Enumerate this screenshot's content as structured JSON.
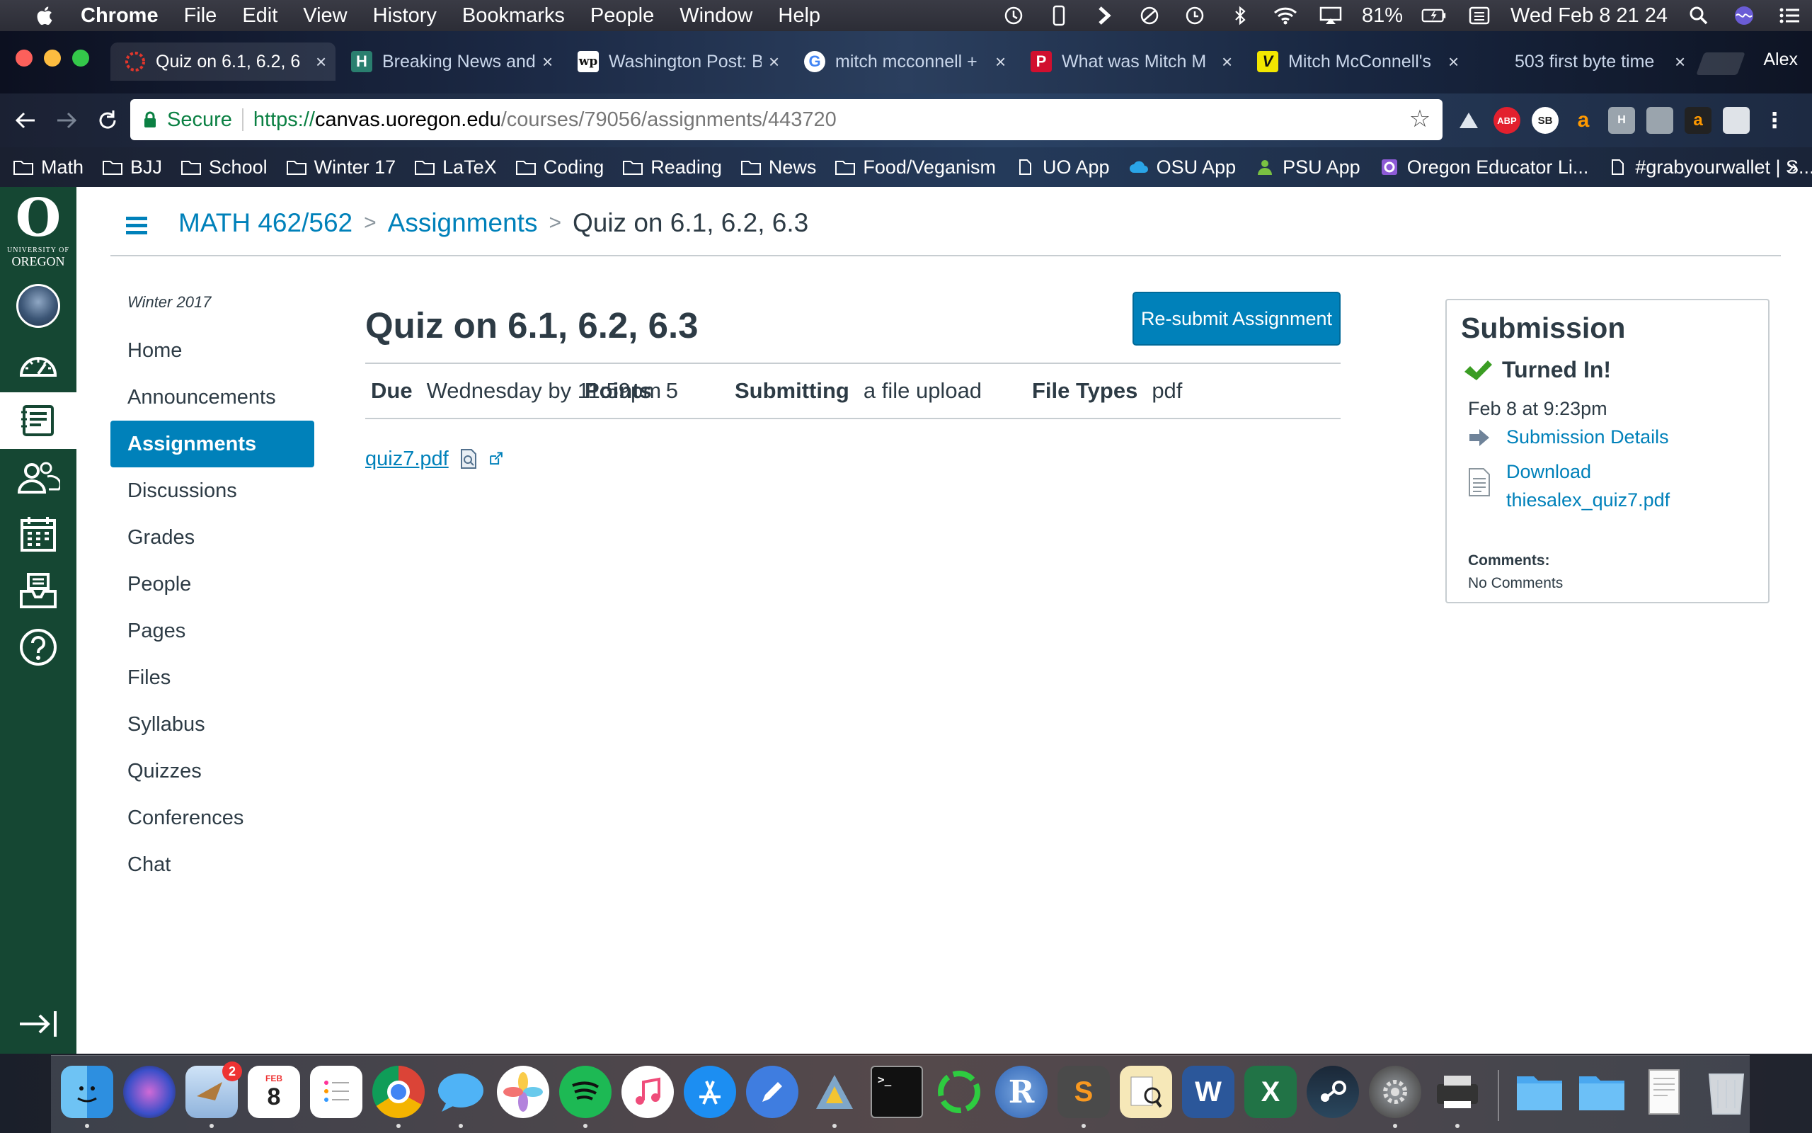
{
  "menubar": {
    "apple_icon": "apple-logo-icon",
    "items": [
      "Chrome",
      "File",
      "Edit",
      "View",
      "History",
      "Bookmarks",
      "People",
      "Window",
      "Help"
    ],
    "battery": "81%",
    "clock": "Wed Feb 8  21 24",
    "status_icons": [
      "time-machine-icon",
      "phone-icon",
      "dropzone-icon",
      "dnd-icon",
      "history-icon",
      "bluetooth-icon",
      "wifi-icon",
      "airplay-icon",
      "battery-icon",
      "keyboard-icon",
      "spotlight-icon",
      "siri-icon",
      "notification-center-icon"
    ]
  },
  "tabs": [
    {
      "title": "Quiz on 6.1, 6.2, 6",
      "favicon": "canvas",
      "color": "#e0362c",
      "active": true
    },
    {
      "title": "Breaking News and",
      "favicon": "H",
      "color": "#2a7f6f"
    },
    {
      "title": "Washington Post: B",
      "favicon": "wp",
      "color": "#222222"
    },
    {
      "title": "mitch mcconnell +",
      "favicon": "G",
      "color": "#4285f4"
    },
    {
      "title": "What was Mitch M",
      "favicon": "P",
      "color": "#d10f2f"
    },
    {
      "title": "Mitch McConnell's",
      "favicon": "V",
      "color": "#f2e600"
    },
    {
      "title": "503 first byte time",
      "favicon": "",
      "color": "#888888"
    }
  ],
  "profile": "Alex",
  "omnibox": {
    "secure_label": "Secure",
    "url_scheme": "https://",
    "url_host": "canvas.uoregon.edu",
    "url_path": "/courses/79056/assignments/443720"
  },
  "extensions": [
    "mustache-icon",
    "adblock-plus-icon",
    "sb-icon",
    "amazon-icon",
    "ext-h-icon",
    "ext-page-icon",
    "amazon-assistant-icon",
    "bookmark-ext-icon",
    "menu-icon"
  ],
  "bookmarks": [
    {
      "label": "Math",
      "icon": "folder-icon"
    },
    {
      "label": "BJJ",
      "icon": "folder-icon"
    },
    {
      "label": "School",
      "icon": "folder-icon"
    },
    {
      "label": "Winter 17",
      "icon": "folder-icon"
    },
    {
      "label": "LaTeX",
      "icon": "folder-icon"
    },
    {
      "label": "Coding",
      "icon": "folder-icon"
    },
    {
      "label": "Reading",
      "icon": "folder-icon"
    },
    {
      "label": "News",
      "icon": "folder-icon"
    },
    {
      "label": "Food/Veganism",
      "icon": "folder-icon"
    },
    {
      "label": "UO App",
      "icon": "page-icon"
    },
    {
      "label": "OSU App",
      "icon": "cloud-icon"
    },
    {
      "label": "PSU App",
      "icon": "person-icon"
    },
    {
      "label": "Oregon Educator Li...",
      "icon": "circle-icon"
    },
    {
      "label": "#grabyourwallet | S...",
      "icon": "page-icon"
    }
  ],
  "globalnav": {
    "logo_letter": "O",
    "logo_small": "UNIVERSITY OF",
    "logo_name": "OREGON",
    "items": [
      "account",
      "dashboard",
      "courses",
      "groups",
      "calendar",
      "inbox",
      "help"
    ]
  },
  "breadcrumb": {
    "course": "MATH 462/562",
    "section": "Assignments",
    "current": "Quiz on 6.1, 6.2, 6.3",
    "separator": ">"
  },
  "course_nav": {
    "term": "Winter 2017",
    "items": [
      "Home",
      "Announcements",
      "Assignments",
      "Discussions",
      "Grades",
      "People",
      "Pages",
      "Files",
      "Syllabus",
      "Quizzes",
      "Conferences",
      "Chat"
    ],
    "active": "Assignments"
  },
  "assignment": {
    "title": "Quiz on 6.1, 6.2, 6.3",
    "resubmit_label": "Re-submit Assignment",
    "due_label": "Due",
    "due_value": "Wednesday by 11:59pm",
    "points_label": "Points",
    "points_value": "5",
    "submitting_label": "Submitting",
    "submitting_value": "a file upload",
    "filetypes_label": "File Types",
    "filetypes_value": "pdf",
    "file_link": "quiz7.pdf"
  },
  "submission": {
    "title": "Submission",
    "status": "Turned In!",
    "date": "Feb 8 at 9:23pm",
    "details_link": "Submission Details",
    "download_line1": "Download",
    "download_line2": "thiesalex_quiz7.pdf",
    "comments_label": "Comments:",
    "comments_value": "No Comments"
  },
  "dock": {
    "apps": [
      "finder",
      "siri",
      "mail",
      "calendar",
      "reminders",
      "chrome",
      "messages",
      "photos",
      "spotify",
      "itunes",
      "app-store",
      "notability",
      "cyberduck",
      "terminal",
      "shiny",
      "r",
      "sublime",
      "preview",
      "word",
      "excel",
      "steam",
      "system-preferences",
      "printer"
    ],
    "calendar_month": "FEB",
    "calendar_day": "8",
    "mail_badge": "2",
    "trailing": [
      "folder",
      "folder",
      "document",
      "trash"
    ]
  },
  "colors": {
    "canvas_nav": "#154733",
    "link": "#0081ba",
    "text": "#2d3b45",
    "success": "#3a9d23"
  }
}
